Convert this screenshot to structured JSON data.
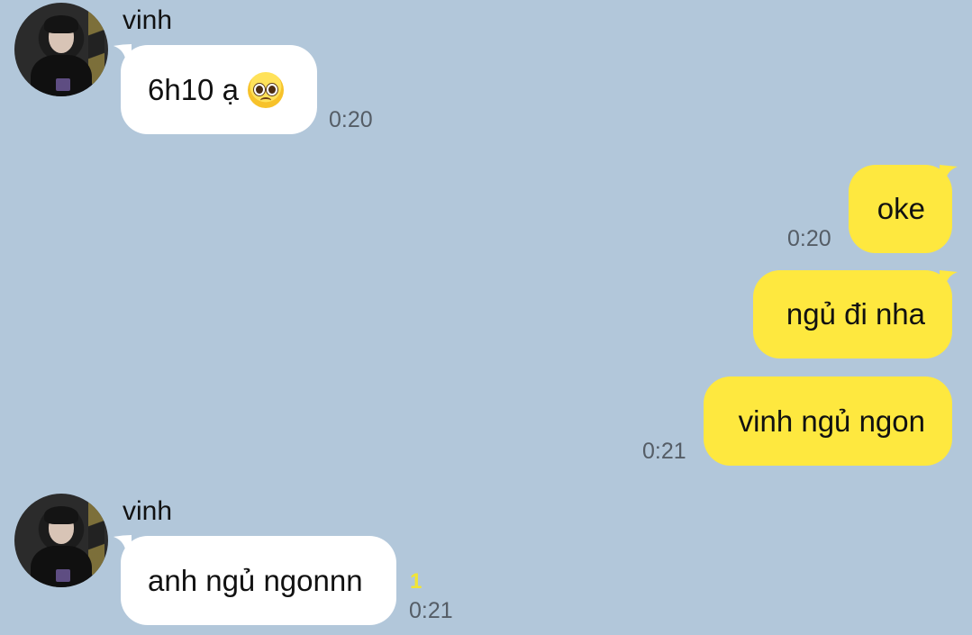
{
  "messages": [
    {
      "direction": "incoming",
      "sender": "vinh",
      "text": "6h10 ạ",
      "emoji": "pleading-face",
      "time": "0:20"
    },
    {
      "direction": "outgoing",
      "text": "oke",
      "time": "0:20"
    },
    {
      "direction": "outgoing",
      "text": "ngủ đi nha"
    },
    {
      "direction": "outgoing",
      "text": "vinh ngủ ngon",
      "time": "0:21"
    },
    {
      "direction": "incoming",
      "sender": "vinh",
      "text": "anh ngủ ngonnn",
      "unread": "1",
      "time": "0:21"
    }
  ],
  "colors": {
    "background": "#b2c7da",
    "incoming_bubble": "#ffffff",
    "outgoing_bubble": "#fee83f",
    "timestamp": "#555d66",
    "unread_count": "#f2e533"
  }
}
